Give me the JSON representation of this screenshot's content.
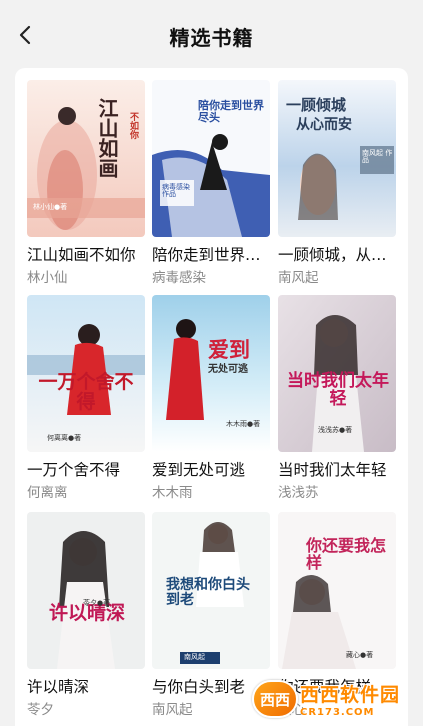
{
  "header": {
    "title": "精选书籍"
  },
  "books": [
    {
      "title": "江山如画不如你",
      "author": "林小仙",
      "cover": {
        "main": "江山如画",
        "sub": "不如你",
        "credit": "林小仙●著"
      }
    },
    {
      "title": "陪你走到世界尽头",
      "author": "病毒感染",
      "cover": {
        "main": "陪你走到世界尽头",
        "credit": "病毒感染 作品"
      }
    },
    {
      "title": "一顾倾城，从心而安",
      "author": "南风起",
      "cover": {
        "main": "一顾倾城",
        "sub": "从心而安",
        "credit": "南风起 作品"
      }
    },
    {
      "title": "一万个舍不得",
      "author": "何离离",
      "cover": {
        "main": "一万个舍不得",
        "credit": "何离离●著"
      }
    },
    {
      "title": "爱到无处可逃",
      "author": "木木雨",
      "cover": {
        "main": "爱到",
        "sub": "无处可逃",
        "credit": "木木雨●著"
      }
    },
    {
      "title": "当时我们太年轻",
      "author": "浅浅苏",
      "cover": {
        "main": "当时我们太年轻",
        "credit": "浅浅苏●著"
      }
    },
    {
      "title": "许以晴深",
      "author": "苓夕",
      "cover": {
        "main": "许以晴深",
        "credit": "苓夕●著"
      }
    },
    {
      "title": "与你白头到老",
      "author": "南风起",
      "cover": {
        "main": "我想和你白头到老",
        "credit": "南风起"
      }
    },
    {
      "title": "你还要我怎样",
      "author": "藏心",
      "cover": {
        "main": "你还要我怎样",
        "credit": "藏心●著"
      }
    }
  ],
  "watermark": {
    "name": "西西软件园",
    "domain": "CR173.COM",
    "badge": "西西"
  },
  "icons": {
    "back": "chevron-left-icon"
  },
  "colors": {
    "background": "#f2f2f2",
    "card": "#ffffff",
    "author": "#8a8a8a",
    "watermark": "#ff8a00"
  }
}
